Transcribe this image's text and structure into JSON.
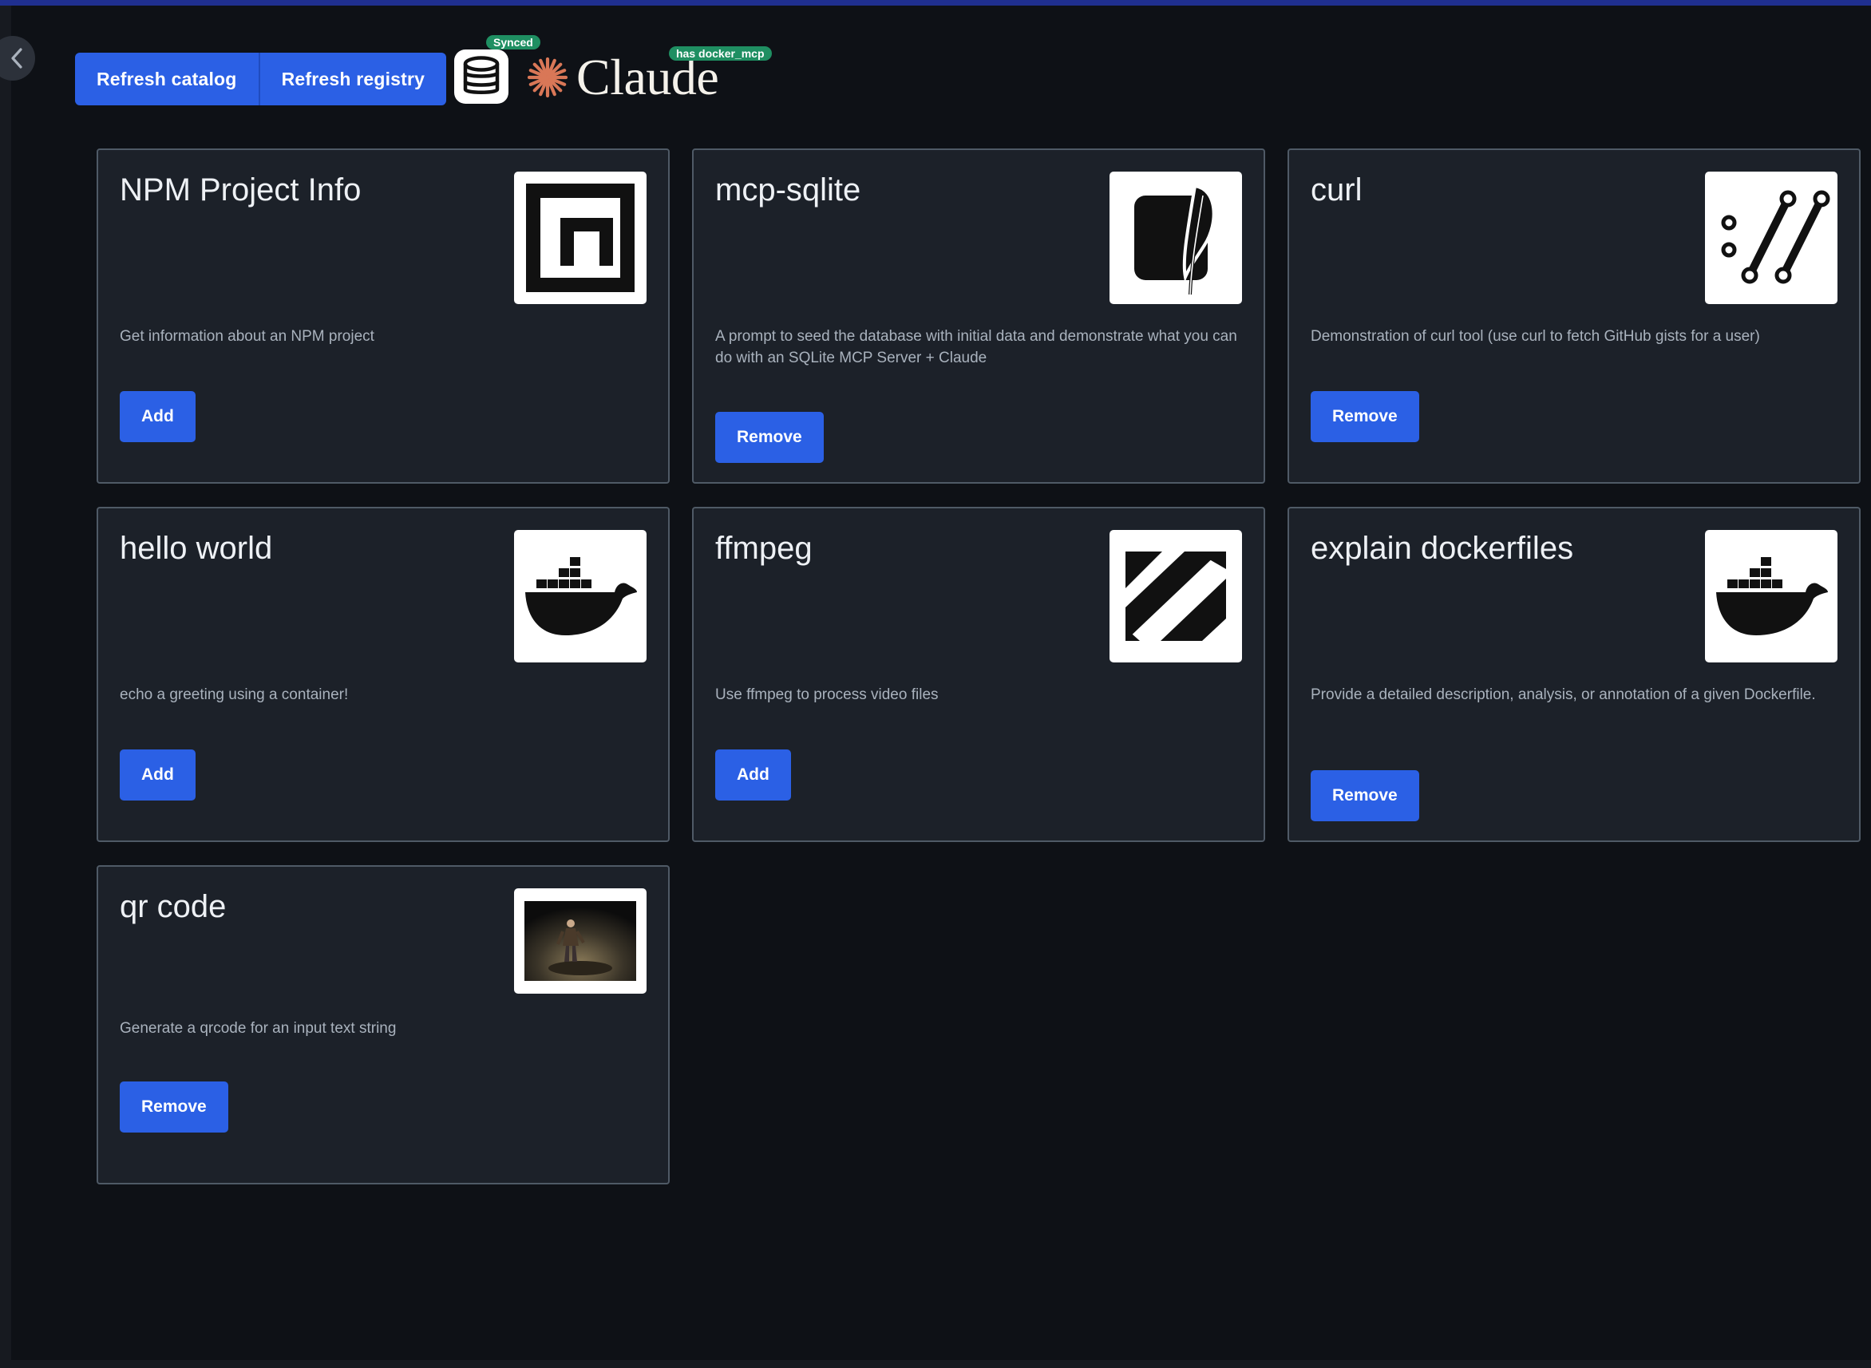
{
  "header": {
    "refresh_catalog_label": "Refresh catalog",
    "refresh_registry_label": "Refresh registry",
    "synced_badge": "Synced",
    "client_name": "Claude",
    "client_badge": "has docker_mcp"
  },
  "colors": {
    "background": "#0e1116",
    "card_background": "#1c2129",
    "card_border": "#4f5a66",
    "accent_button": "#2b60e5",
    "badge_green": "#1f8f62",
    "claude_orange": "#d97757"
  },
  "cards": [
    {
      "title": "NPM Project Info",
      "description": "Get information about an NPM project",
      "action": "Add",
      "icon": "npm-logo-icon"
    },
    {
      "title": "mcp-sqlite",
      "description": "A prompt to seed the database with initial data and demonstrate what you can do with an SQLite MCP Server + Claude",
      "action": "Remove",
      "icon": "sqlite-feather-icon"
    },
    {
      "title": "curl",
      "description": "Demonstration of curl tool (use curl to fetch GitHub gists for a user)",
      "action": "Remove",
      "icon": "curl-logo-icon"
    },
    {
      "title": "hello world",
      "description": "echo a greeting using a container!",
      "action": "Add",
      "icon": "docker-whale-icon"
    },
    {
      "title": "ffmpeg",
      "description": "Use ffmpeg to process video files",
      "action": "Add",
      "icon": "ffmpeg-logo-icon"
    },
    {
      "title": "explain dockerfiles",
      "description": "Provide a detailed description, analysis, or annotation of a given Dockerfile.",
      "action": "Remove",
      "icon": "docker-whale-icon"
    },
    {
      "title": "qr code",
      "description": "Generate a qrcode for an input text string",
      "action": "Remove",
      "icon": "photo-thumbnail"
    }
  ]
}
